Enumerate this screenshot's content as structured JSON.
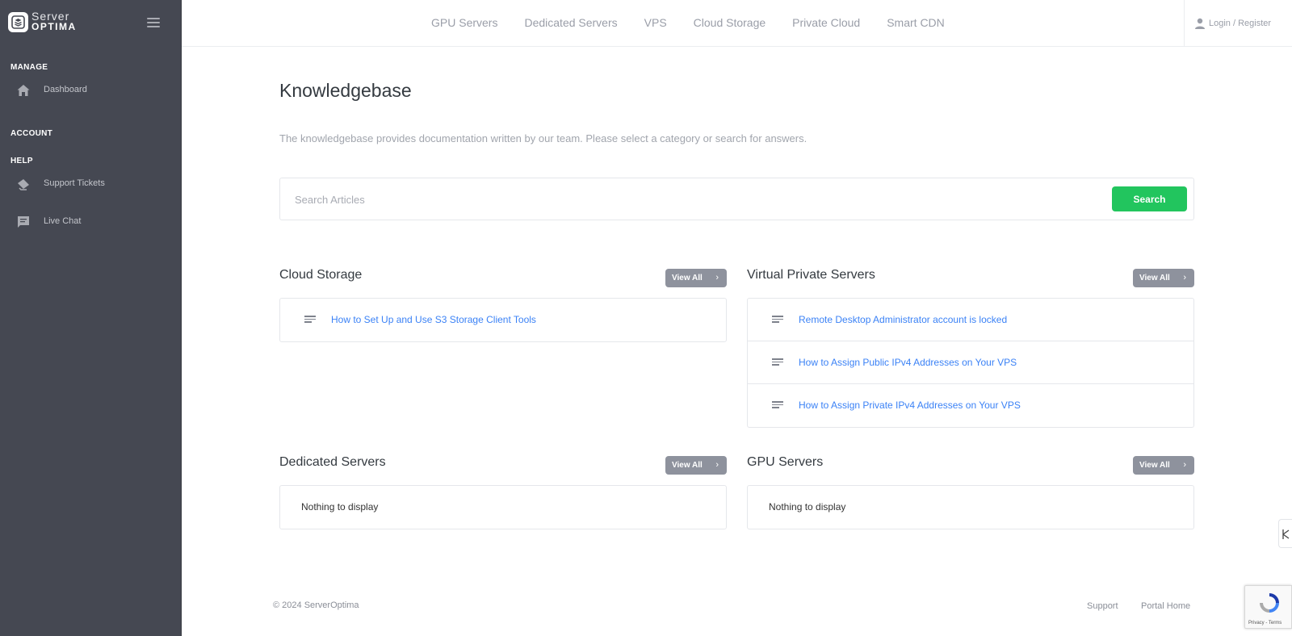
{
  "brand": {
    "top": "Server",
    "bottom": "OPTIMA"
  },
  "sidebar": {
    "sections": [
      {
        "label": "MANAGE",
        "items": [
          {
            "label": "Dashboard",
            "icon": "home-icon"
          }
        ]
      },
      {
        "label": "ACCOUNT",
        "items": []
      },
      {
        "label": "HELP",
        "items": [
          {
            "label": "Support Tickets",
            "icon": "ticket-icon"
          },
          {
            "label": "Live Chat",
            "icon": "chat-icon"
          }
        ]
      }
    ]
  },
  "topnav": {
    "items": [
      "GPU Servers",
      "Dedicated Servers",
      "VPS",
      "Cloud Storage",
      "Private Cloud",
      "Smart CDN"
    ],
    "login": "Login / Register"
  },
  "main": {
    "title": "Knowledgebase",
    "description": "The knowledgebase provides documentation written by our team. Please select a category or search for answers.",
    "search": {
      "placeholder": "Search Articles",
      "button": "Search"
    },
    "view_all_label": "View All",
    "categories": [
      {
        "title": "Cloud Storage",
        "articles": [
          "How to Set Up and Use S3 Storage Client Tools"
        ]
      },
      {
        "title": "Virtual Private Servers",
        "articles": [
          "Remote Desktop Administrator account is locked",
          "How to Assign Public IPv4 Addresses on Your VPS",
          "How to Assign Private IPv4 Addresses on Your VPS"
        ]
      },
      {
        "title": "Dedicated Servers",
        "empty": "Nothing to display"
      },
      {
        "title": "GPU Servers",
        "empty": "Nothing to display"
      }
    ]
  },
  "footer": {
    "copyright": "© 2024 ServerOptima",
    "links": [
      "Support",
      "Portal Home"
    ]
  },
  "recaptcha": {
    "text": "Privacy - Terms"
  },
  "colors": {
    "sidebar_bg": "#454852",
    "accent_green": "#22c55e",
    "link_blue": "#3b82f6",
    "view_all_bg": "#8e929d"
  }
}
